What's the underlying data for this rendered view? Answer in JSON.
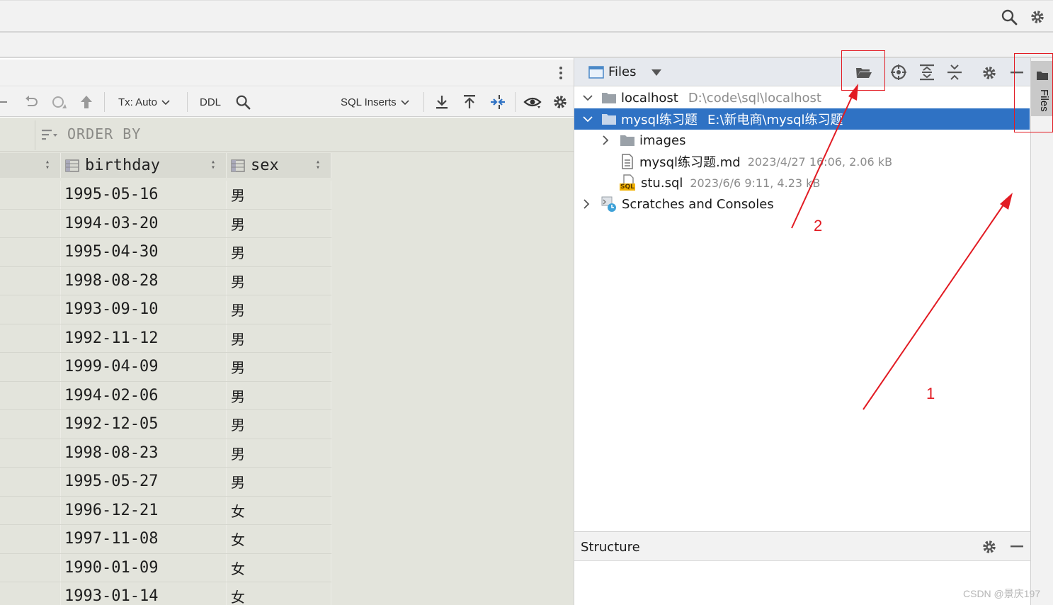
{
  "editor": {
    "toolbar": {
      "tx_mode": "Tx: Auto",
      "ddl": "DDL",
      "export_format": "SQL Inserts"
    },
    "order_by_label": "ORDER BY",
    "columns": [
      "birthday",
      "sex"
    ],
    "rows": [
      {
        "birthday": "1995-05-16",
        "sex": "男"
      },
      {
        "birthday": "1994-03-20",
        "sex": "男"
      },
      {
        "birthday": "1995-04-30",
        "sex": "男"
      },
      {
        "birthday": "1998-08-28",
        "sex": "男"
      },
      {
        "birthday": "1993-09-10",
        "sex": "男"
      },
      {
        "birthday": "1992-11-12",
        "sex": "男"
      },
      {
        "birthday": "1999-04-09",
        "sex": "男"
      },
      {
        "birthday": "1994-02-06",
        "sex": "男"
      },
      {
        "birthday": "1992-12-05",
        "sex": "男"
      },
      {
        "birthday": "1998-08-23",
        "sex": "男"
      },
      {
        "birthday": "1995-05-27",
        "sex": "男"
      },
      {
        "birthday": "1996-12-21",
        "sex": "女"
      },
      {
        "birthday": "1997-11-08",
        "sex": "女"
      },
      {
        "birthday": "1990-01-09",
        "sex": "女"
      },
      {
        "birthday": "1993-01-14",
        "sex": "女"
      }
    ]
  },
  "files_panel": {
    "title": "Files",
    "tree": [
      {
        "label": "localhost",
        "meta": "D:\\code\\sql\\localhost"
      },
      {
        "label": "mysql练习题",
        "meta": "E:\\新电商\\mysql练习题"
      },
      {
        "label": "images",
        "meta": ""
      },
      {
        "label": "mysql练习题.md",
        "meta": "2023/4/27 16:06, 2.06 kB"
      },
      {
        "label": "stu.sql",
        "meta": "2023/6/6 9:11, 4.23 kB"
      },
      {
        "label": "Scratches and Consoles",
        "meta": ""
      }
    ],
    "sql_badge": "SQL"
  },
  "structure_panel": {
    "title": "Structure"
  },
  "side_strip": {
    "files_tab": "Files"
  },
  "annotations": {
    "label_1": "1",
    "label_2": "2"
  },
  "watermark": "CSDN @景庆197",
  "colors": {
    "selection": "#2f72c4",
    "annotation": "#e21b23",
    "grid_bg": "#e3e4dc"
  }
}
